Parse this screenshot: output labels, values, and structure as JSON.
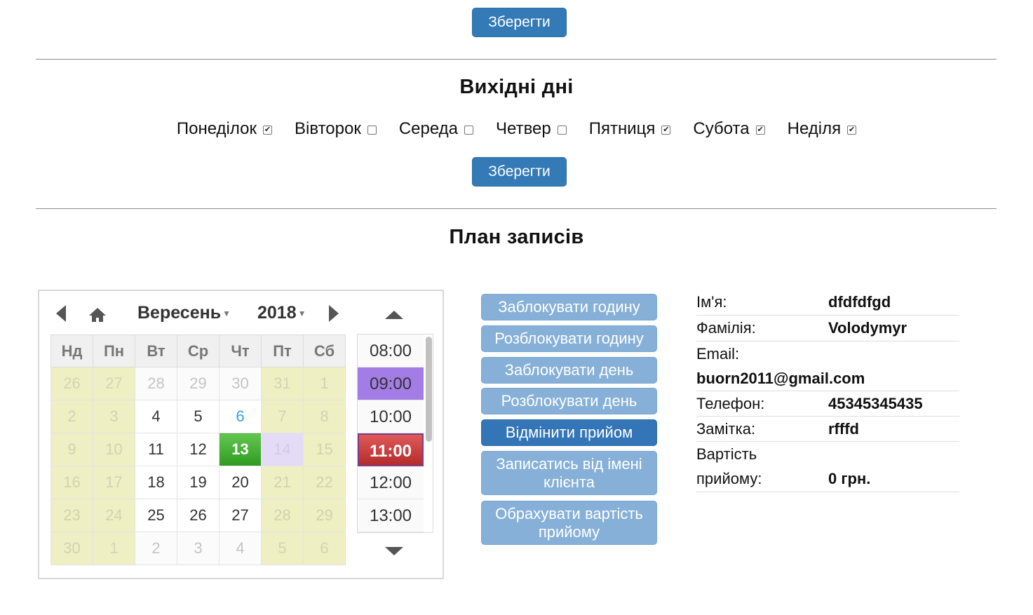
{
  "top": {
    "save_label": "Зберегти"
  },
  "weekends": {
    "title": "Вихідні дні",
    "days": [
      {
        "label": "Понеділок",
        "checked": true
      },
      {
        "label": "Вівторок",
        "checked": false
      },
      {
        "label": "Середа",
        "checked": false
      },
      {
        "label": "Четвер",
        "checked": false
      },
      {
        "label": "Пятниця",
        "checked": true
      },
      {
        "label": "Субота",
        "checked": true
      },
      {
        "label": "Неділя",
        "checked": true
      }
    ],
    "save_label": "Зберегти"
  },
  "plan": {
    "title": "План записів",
    "calendar": {
      "month": "Вересень",
      "year": "2018",
      "weekdays": [
        "Нд",
        "Пн",
        "Вт",
        "Ср",
        "Чт",
        "Пт",
        "Сб"
      ],
      "weeks": [
        [
          "26",
          "27",
          "28",
          "29",
          "30",
          "31",
          "1"
        ],
        [
          "2",
          "3",
          "4",
          "5",
          "6",
          "7",
          "8"
        ],
        [
          "9",
          "10",
          "11",
          "12",
          "13",
          "14",
          "15"
        ],
        [
          "16",
          "17",
          "18",
          "19",
          "20",
          "21",
          "22"
        ],
        [
          "23",
          "24",
          "25",
          "26",
          "27",
          "28",
          "29"
        ],
        [
          "30",
          "1",
          "2",
          "3",
          "4",
          "5",
          "6"
        ]
      ],
      "selected_day": "13",
      "today": "6"
    },
    "times": [
      "08:00",
      "09:00",
      "10:00",
      "11:00",
      "12:00",
      "13:00"
    ],
    "selected_time": "11:00",
    "actions": [
      "Заблокувати годину",
      "Розблокувати годину",
      "Заблокувати день",
      "Розблокувати день",
      "Відмінити прийом",
      "Записатись від імені клієнта",
      "Обрахувати вартість прийому"
    ],
    "info": {
      "name_label": "Ім'я:",
      "name": "dfdfdfgd",
      "surname_label": "Фамілія:",
      "surname": "Volodymyr",
      "email_label": "Email:",
      "email": "buorn2011@gmail.com",
      "phone_label": "Телефон:",
      "phone": "45345345435",
      "note_label": "Замітка:",
      "note": "rfffd",
      "cost_label_1": "Вартість",
      "cost_label_2": "прийому:",
      "cost": "0 грн."
    }
  }
}
